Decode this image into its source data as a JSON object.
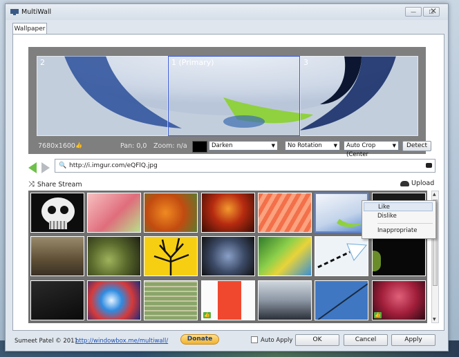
{
  "window": {
    "title": "MultiWall",
    "controls": {
      "minimize": "—",
      "maximize": "☐",
      "close": "✕"
    }
  },
  "tabs": [
    {
      "label": "Wallpaper",
      "active": true
    }
  ],
  "preview": {
    "monitors": [
      {
        "label": "2"
      },
      {
        "label": "1 (Primary)",
        "selected": true
      },
      {
        "label": "3"
      }
    ],
    "resolution": "7680x1600",
    "pan": "Pan: 0,0",
    "zoom": "Zoom: n/a",
    "background_color": "#000000",
    "blend_mode": "Darken",
    "rotation": "No Rotation",
    "crop": "Auto Crop (Center",
    "detect_label": "Detect"
  },
  "address": {
    "url": "http://i.imgur.com/eQFlQ.jpg",
    "back_icon": "arrow-left-icon",
    "forward_icon": "arrow-right-icon"
  },
  "stream": {
    "share_label": "Share Stream",
    "upload_label": "Upload"
  },
  "thumbnails": [
    {
      "name": "skull"
    },
    {
      "name": "pink-flower"
    },
    {
      "name": "orange-flowers"
    },
    {
      "name": "red-dragon"
    },
    {
      "name": "orange-stripes"
    },
    {
      "name": "glass-bowl",
      "selected": true
    },
    {
      "name": "dark-leaf"
    },
    {
      "name": "stone-building"
    },
    {
      "name": "succulent"
    },
    {
      "name": "yellow-tree"
    },
    {
      "name": "robot"
    },
    {
      "name": "green-blue-stripes"
    },
    {
      "name": "arrow-sky"
    },
    {
      "name": "green-leaf-dark"
    },
    {
      "name": "keyboard"
    },
    {
      "name": "colorful-swirl"
    },
    {
      "name": "aerial-map"
    },
    {
      "name": "red-bottle",
      "liked": true
    },
    {
      "name": "opera-house"
    },
    {
      "name": "blue-sky-line"
    },
    {
      "name": "red-sculpture",
      "liked": true
    }
  ],
  "context_menu": {
    "items": [
      "Like",
      "Dislike",
      "Inappropriate"
    ],
    "highlighted": "Like"
  },
  "footer": {
    "copyright": "Sumeet Patel © 2011",
    "link": "http://windowbox.me/multiwall/",
    "donate": "Donate",
    "auto_apply_label": "Auto Apply",
    "auto_apply_checked": false,
    "ok": "OK",
    "cancel": "Cancel",
    "apply": "Apply"
  }
}
